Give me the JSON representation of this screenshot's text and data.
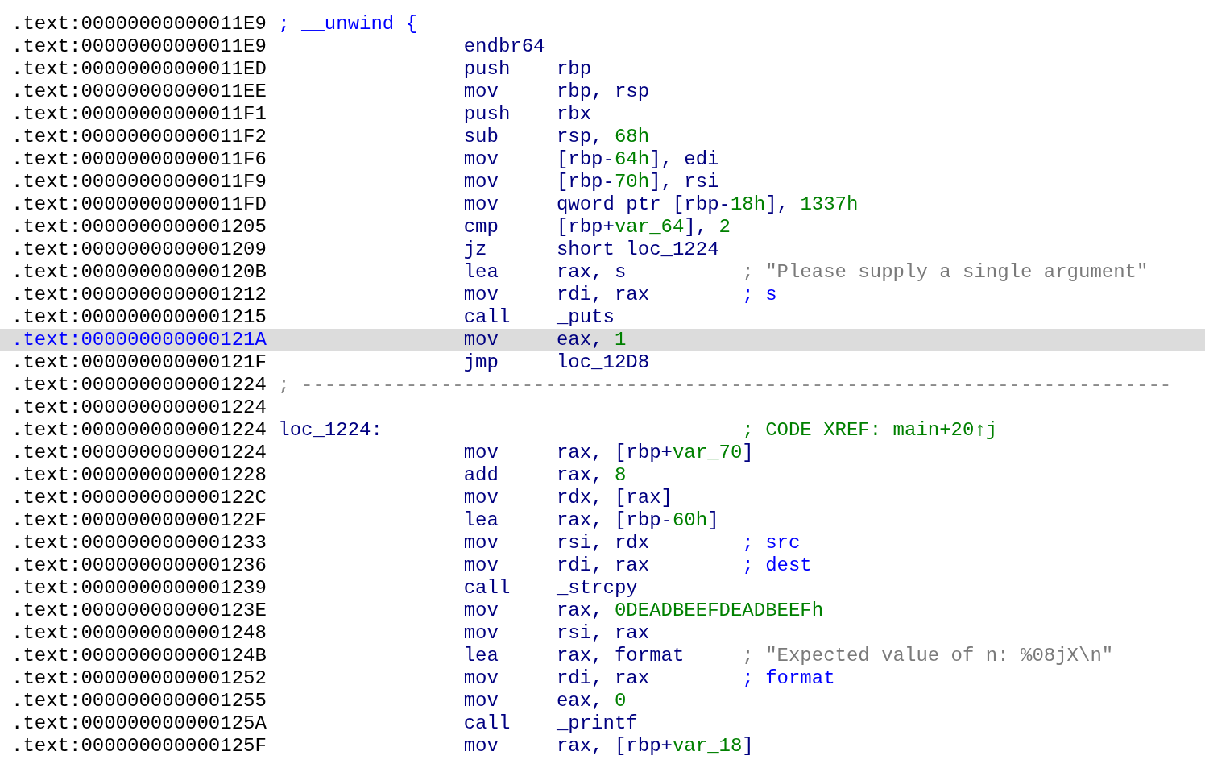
{
  "listing": {
    "rows": [
      {
        "address": ".text:00000000000011E9",
        "selected": false,
        "kind": "note",
        "note": {
          "text": "; __unwind {",
          "kind": "auto"
        }
      },
      {
        "address": ".text:00000000000011E9",
        "selected": false,
        "kind": "code",
        "mnemonic": "endbr64"
      },
      {
        "address": ".text:00000000000011ED",
        "selected": false,
        "kind": "code",
        "mnemonic": "push",
        "operands": [
          {
            "text": "rbp",
            "kind": "plain"
          }
        ]
      },
      {
        "address": ".text:00000000000011EE",
        "selected": false,
        "kind": "code",
        "mnemonic": "mov",
        "operands": [
          {
            "text": "rbp, rsp",
            "kind": "plain"
          }
        ]
      },
      {
        "address": ".text:00000000000011F1",
        "selected": false,
        "kind": "code",
        "mnemonic": "push",
        "operands": [
          {
            "text": "rbx",
            "kind": "plain"
          }
        ]
      },
      {
        "address": ".text:00000000000011F2",
        "selected": false,
        "kind": "code",
        "mnemonic": "sub",
        "operands": [
          {
            "text": "rsp, ",
            "kind": "plain"
          },
          {
            "text": "68h",
            "kind": "number"
          }
        ]
      },
      {
        "address": ".text:00000000000011F6",
        "selected": false,
        "kind": "code",
        "mnemonic": "mov",
        "operands": [
          {
            "text": "[rbp-",
            "kind": "plain"
          },
          {
            "text": "64h",
            "kind": "number"
          },
          {
            "text": "], edi",
            "kind": "plain"
          }
        ]
      },
      {
        "address": ".text:00000000000011F9",
        "selected": false,
        "kind": "code",
        "mnemonic": "mov",
        "operands": [
          {
            "text": "[rbp-",
            "kind": "plain"
          },
          {
            "text": "70h",
            "kind": "number"
          },
          {
            "text": "], rsi",
            "kind": "plain"
          }
        ]
      },
      {
        "address": ".text:00000000000011FD",
        "selected": false,
        "kind": "code",
        "mnemonic": "mov",
        "operands": [
          {
            "text": "qword ptr [rbp-",
            "kind": "plain"
          },
          {
            "text": "18h",
            "kind": "number"
          },
          {
            "text": "], ",
            "kind": "plain"
          },
          {
            "text": "1337h",
            "kind": "number"
          }
        ]
      },
      {
        "address": ".text:0000000000001205",
        "selected": false,
        "kind": "code",
        "mnemonic": "cmp",
        "operands": [
          {
            "text": "[rbp+",
            "kind": "plain"
          },
          {
            "text": "var_64",
            "kind": "number"
          },
          {
            "text": "], ",
            "kind": "plain"
          },
          {
            "text": "2",
            "kind": "number"
          }
        ]
      },
      {
        "address": ".text:0000000000001209",
        "selected": false,
        "kind": "code",
        "mnemonic": "jz",
        "operands": [
          {
            "text": "short loc_1224",
            "kind": "plain"
          }
        ]
      },
      {
        "address": ".text:000000000000120B",
        "selected": false,
        "kind": "code",
        "mnemonic": "lea",
        "operands": [
          {
            "text": "rax, s",
            "kind": "plain"
          }
        ],
        "comment": {
          "text": "; \"Please supply a single argument\"",
          "kind": "string"
        }
      },
      {
        "address": ".text:0000000000001212",
        "selected": false,
        "kind": "code",
        "mnemonic": "mov",
        "operands": [
          {
            "text": "rdi, rax",
            "kind": "plain"
          }
        ],
        "comment": {
          "text": "; s",
          "kind": "auto"
        }
      },
      {
        "address": ".text:0000000000001215",
        "selected": false,
        "kind": "code",
        "mnemonic": "call",
        "operands": [
          {
            "text": "_puts",
            "kind": "plain"
          }
        ]
      },
      {
        "address": ".text:000000000000121A",
        "selected": true,
        "kind": "code",
        "mnemonic": "mov",
        "operands": [
          {
            "text": "eax, ",
            "kind": "plain"
          },
          {
            "text": "1",
            "kind": "number"
          }
        ]
      },
      {
        "address": ".text:000000000000121F",
        "selected": false,
        "kind": "code",
        "mnemonic": "jmp",
        "operands": [
          {
            "text": "loc_12D8",
            "kind": "plain"
          }
        ]
      },
      {
        "address": ".text:0000000000001224",
        "selected": false,
        "kind": "separator",
        "separator": "; ---------------------------------------------------------------------------"
      },
      {
        "address": ".text:0000000000001224",
        "selected": false,
        "kind": "blank"
      },
      {
        "address": ".text:0000000000001224",
        "selected": false,
        "kind": "label",
        "label": "loc_1224:",
        "comment": {
          "text": "; CODE XREF: main+20↑j",
          "kind": "xref"
        }
      },
      {
        "address": ".text:0000000000001224",
        "selected": false,
        "kind": "code",
        "mnemonic": "mov",
        "operands": [
          {
            "text": "rax, [rbp+",
            "kind": "plain"
          },
          {
            "text": "var_70",
            "kind": "number"
          },
          {
            "text": "]",
            "kind": "plain"
          }
        ]
      },
      {
        "address": ".text:0000000000001228",
        "selected": false,
        "kind": "code",
        "mnemonic": "add",
        "operands": [
          {
            "text": "rax, ",
            "kind": "plain"
          },
          {
            "text": "8",
            "kind": "number"
          }
        ]
      },
      {
        "address": ".text:000000000000122C",
        "selected": false,
        "kind": "code",
        "mnemonic": "mov",
        "operands": [
          {
            "text": "rdx, [rax]",
            "kind": "plain"
          }
        ]
      },
      {
        "address": ".text:000000000000122F",
        "selected": false,
        "kind": "code",
        "mnemonic": "lea",
        "operands": [
          {
            "text": "rax, [rbp-",
            "kind": "plain"
          },
          {
            "text": "60h",
            "kind": "number"
          },
          {
            "text": "]",
            "kind": "plain"
          }
        ]
      },
      {
        "address": ".text:0000000000001233",
        "selected": false,
        "kind": "code",
        "mnemonic": "mov",
        "operands": [
          {
            "text": "rsi, rdx",
            "kind": "plain"
          }
        ],
        "comment": {
          "text": "; src",
          "kind": "auto"
        }
      },
      {
        "address": ".text:0000000000001236",
        "selected": false,
        "kind": "code",
        "mnemonic": "mov",
        "operands": [
          {
            "text": "rdi, rax",
            "kind": "plain"
          }
        ],
        "comment": {
          "text": "; dest",
          "kind": "auto"
        }
      },
      {
        "address": ".text:0000000000001239",
        "selected": false,
        "kind": "code",
        "mnemonic": "call",
        "operands": [
          {
            "text": "_strcpy",
            "kind": "plain"
          }
        ]
      },
      {
        "address": ".text:000000000000123E",
        "selected": false,
        "kind": "code",
        "mnemonic": "mov",
        "operands": [
          {
            "text": "rax, ",
            "kind": "plain"
          },
          {
            "text": "0DEADBEEFDEADBEEFh",
            "kind": "number"
          }
        ]
      },
      {
        "address": ".text:0000000000001248",
        "selected": false,
        "kind": "code",
        "mnemonic": "mov",
        "operands": [
          {
            "text": "rsi, rax",
            "kind": "plain"
          }
        ]
      },
      {
        "address": ".text:000000000000124B",
        "selected": false,
        "kind": "code",
        "mnemonic": "lea",
        "operands": [
          {
            "text": "rax, format",
            "kind": "plain"
          }
        ],
        "comment": {
          "text": "; \"Expected value of n: %08jX\\n\"",
          "kind": "string"
        }
      },
      {
        "address": ".text:0000000000001252",
        "selected": false,
        "kind": "code",
        "mnemonic": "mov",
        "operands": [
          {
            "text": "rdi, rax",
            "kind": "plain"
          }
        ],
        "comment": {
          "text": "; format",
          "kind": "auto"
        }
      },
      {
        "address": ".text:0000000000001255",
        "selected": false,
        "kind": "code",
        "mnemonic": "mov",
        "operands": [
          {
            "text": "eax, ",
            "kind": "plain"
          },
          {
            "text": "0",
            "kind": "number"
          }
        ]
      },
      {
        "address": ".text:000000000000125A",
        "selected": false,
        "kind": "code",
        "mnemonic": "call",
        "operands": [
          {
            "text": "_printf",
            "kind": "plain"
          }
        ]
      },
      {
        "address": ".text:000000000000125F",
        "selected": false,
        "kind": "code",
        "mnemonic": "mov",
        "operands": [
          {
            "text": "rax, [rbp+",
            "kind": "plain"
          },
          {
            "text": "var_18",
            "kind": "number"
          },
          {
            "text": "]",
            "kind": "plain"
          }
        ]
      }
    ]
  }
}
